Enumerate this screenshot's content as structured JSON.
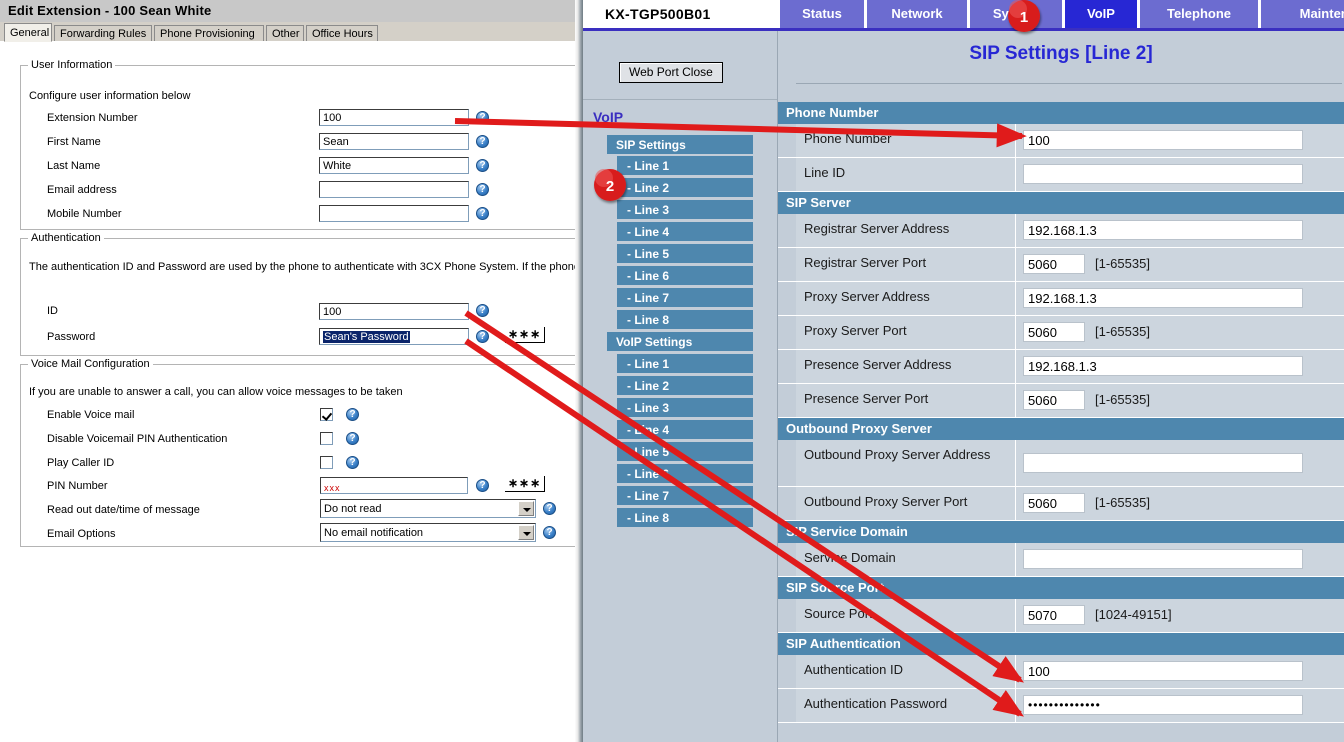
{
  "left_dialog": {
    "title": "Edit Extension - 100 Sean White",
    "tabs": [
      {
        "label": "General",
        "active": true
      },
      {
        "label": "Forwarding Rules",
        "active": false
      },
      {
        "label": "Phone Provisioning",
        "active": false
      },
      {
        "label": "Other",
        "active": false
      },
      {
        "label": "Office Hours",
        "active": false
      }
    ],
    "user_information": {
      "group_label": "User Information",
      "hint": "Configure user information below",
      "fields": [
        {
          "label": "Extension Number",
          "value": "100"
        },
        {
          "label": "First Name",
          "value": "Sean"
        },
        {
          "label": "Last Name",
          "value": "White"
        },
        {
          "label": "Email address",
          "value": ""
        },
        {
          "label": "Mobile Number",
          "value": ""
        }
      ]
    },
    "authentication": {
      "group_label": "Authentication",
      "hint": "The authentication ID and Password are used by the phone to authenticate with 3CX Phone System. If the phone ha",
      "id_label": "ID",
      "id_value": "100",
      "password_label": "Password",
      "password_value": "Sean's Password",
      "password_reveal_label": "∗∗∗"
    },
    "voice_mail": {
      "group_label": "Voice Mail Configuration",
      "hint": "If you are unable to answer a call, you can allow voice messages to be taken",
      "enable_label": "Enable Voice mail",
      "enable_checked": true,
      "disable_pin_label": "Disable Voicemail PIN Authentication",
      "disable_pin_checked": false,
      "play_caller_id_label": "Play Caller ID",
      "play_caller_id_checked": false,
      "pin_label": "PIN Number",
      "pin_value": "xxx",
      "pin_reveal_label": "∗∗∗",
      "readout_label": "Read out date/time of message",
      "readout_value": "Do not read",
      "email_options_label": "Email Options",
      "email_options_value": "No email notification"
    }
  },
  "phone_ui": {
    "model": "KX-TGP500B01",
    "nav_tabs": [
      {
        "label": "Status",
        "active": false
      },
      {
        "label": "Network",
        "active": false
      },
      {
        "label": "System",
        "active": false
      },
      {
        "label": "VoIP",
        "active": true
      },
      {
        "label": "Telephone",
        "active": false
      },
      {
        "label": "Maintenance",
        "active": false
      }
    ],
    "web_port_close_label": "Web Port Close",
    "sidebar_heading": "VoIP",
    "sidebar": [
      {
        "label": "SIP Settings",
        "type": "group"
      },
      {
        "label": "- Line 1",
        "type": "item"
      },
      {
        "label": "- Line 2",
        "type": "item"
      },
      {
        "label": "- Line 3",
        "type": "item"
      },
      {
        "label": "- Line 4",
        "type": "item"
      },
      {
        "label": "- Line 5",
        "type": "item"
      },
      {
        "label": "- Line 6",
        "type": "item"
      },
      {
        "label": "- Line 7",
        "type": "item"
      },
      {
        "label": "- Line 8",
        "type": "item"
      },
      {
        "label": "VoIP Settings",
        "type": "group"
      },
      {
        "label": "- Line 1",
        "type": "item"
      },
      {
        "label": "- Line 2",
        "type": "item"
      },
      {
        "label": "- Line 3",
        "type": "item"
      },
      {
        "label": "- Line 4",
        "type": "item"
      },
      {
        "label": "- Line 5",
        "type": "item"
      },
      {
        "label": "- Line 6",
        "type": "item"
      },
      {
        "label": "- Line 7",
        "type": "item"
      },
      {
        "label": "- Line 8",
        "type": "item"
      }
    ],
    "page_title": "SIP Settings [Line 2]",
    "sections": [
      {
        "heading": "Phone Number",
        "rows": [
          {
            "label": "Phone Number",
            "value": "100",
            "width": "wide",
            "hint": ""
          },
          {
            "label": "Line ID",
            "value": "",
            "width": "wide",
            "hint": ""
          }
        ]
      },
      {
        "heading": "SIP Server",
        "rows": [
          {
            "label": "Registrar Server Address",
            "value": "192.168.1.3",
            "width": "wide",
            "hint": ""
          },
          {
            "label": "Registrar Server Port",
            "value": "5060",
            "width": "narrow",
            "hint": "[1-65535]"
          },
          {
            "label": "Proxy Server Address",
            "value": "192.168.1.3",
            "width": "wide",
            "hint": ""
          },
          {
            "label": "Proxy Server Port",
            "value": "5060",
            "width": "narrow",
            "hint": "[1-65535]"
          },
          {
            "label": "Presence Server Address",
            "value": "192.168.1.3",
            "width": "wide",
            "hint": ""
          },
          {
            "label": "Presence Server Port",
            "value": "5060",
            "width": "narrow",
            "hint": "[1-65535]"
          }
        ]
      },
      {
        "heading": "Outbound Proxy Server",
        "rows": [
          {
            "label": "Outbound Proxy Server Address",
            "value": "",
            "width": "wide",
            "hint": "",
            "twoline": true
          },
          {
            "label": "Outbound Proxy Server Port",
            "value": "5060",
            "width": "narrow",
            "hint": "[1-65535]"
          }
        ]
      },
      {
        "heading": "SIP Service Domain",
        "rows": [
          {
            "label": "Service Domain",
            "value": "",
            "width": "wide",
            "hint": ""
          }
        ]
      },
      {
        "heading": "SIP Source Port",
        "rows": [
          {
            "label": "Source Port",
            "value": "5070",
            "width": "narrow",
            "hint": "[1024-49151]"
          }
        ]
      },
      {
        "heading": "SIP Authentication",
        "rows": [
          {
            "label": "Authentication ID",
            "value": "100",
            "width": "wide",
            "hint": ""
          },
          {
            "label": "Authentication Password",
            "value": "••••••••••••••",
            "width": "wide",
            "hint": ""
          }
        ]
      }
    ]
  },
  "annotations": {
    "badges": [
      {
        "label": "1"
      },
      {
        "label": "2"
      }
    ],
    "arrow_color": "#e01b1b"
  }
}
